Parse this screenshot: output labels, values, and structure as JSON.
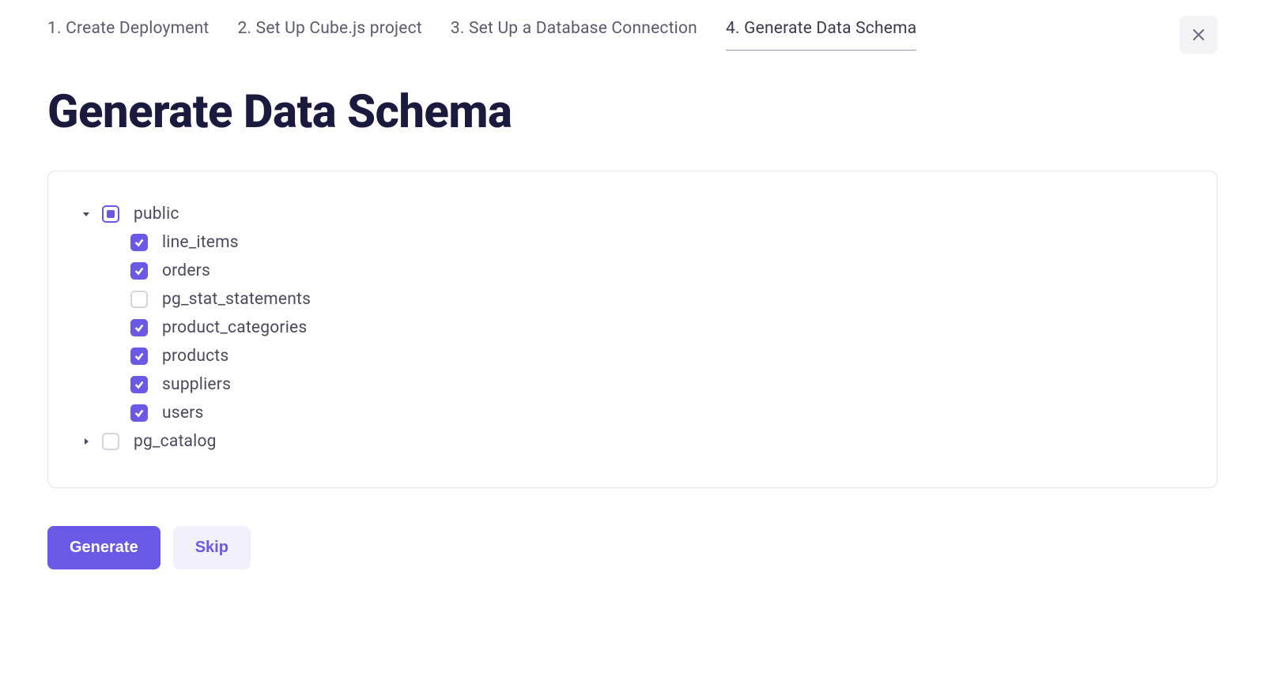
{
  "steps": [
    {
      "label": "1. Create Deployment",
      "active": false
    },
    {
      "label": "2. Set Up Cube.js project",
      "active": false
    },
    {
      "label": "3. Set Up a Database Connection",
      "active": false
    },
    {
      "label": "4. Generate Data Schema",
      "active": true
    }
  ],
  "page_title": "Generate Data Schema",
  "tree": {
    "schemas": [
      {
        "name": "public",
        "expanded": true,
        "check_state": "indeterminate",
        "tables": [
          {
            "name": "line_items",
            "checked": true
          },
          {
            "name": "orders",
            "checked": true
          },
          {
            "name": "pg_stat_statements",
            "checked": false
          },
          {
            "name": "product_categories",
            "checked": true
          },
          {
            "name": "products",
            "checked": true
          },
          {
            "name": "suppliers",
            "checked": true
          },
          {
            "name": "users",
            "checked": true
          }
        ]
      },
      {
        "name": "pg_catalog",
        "expanded": false,
        "check_state": "unchecked",
        "tables": []
      }
    ]
  },
  "actions": {
    "primary_label": "Generate",
    "secondary_label": "Skip"
  },
  "icons": {
    "close": "close-icon"
  }
}
